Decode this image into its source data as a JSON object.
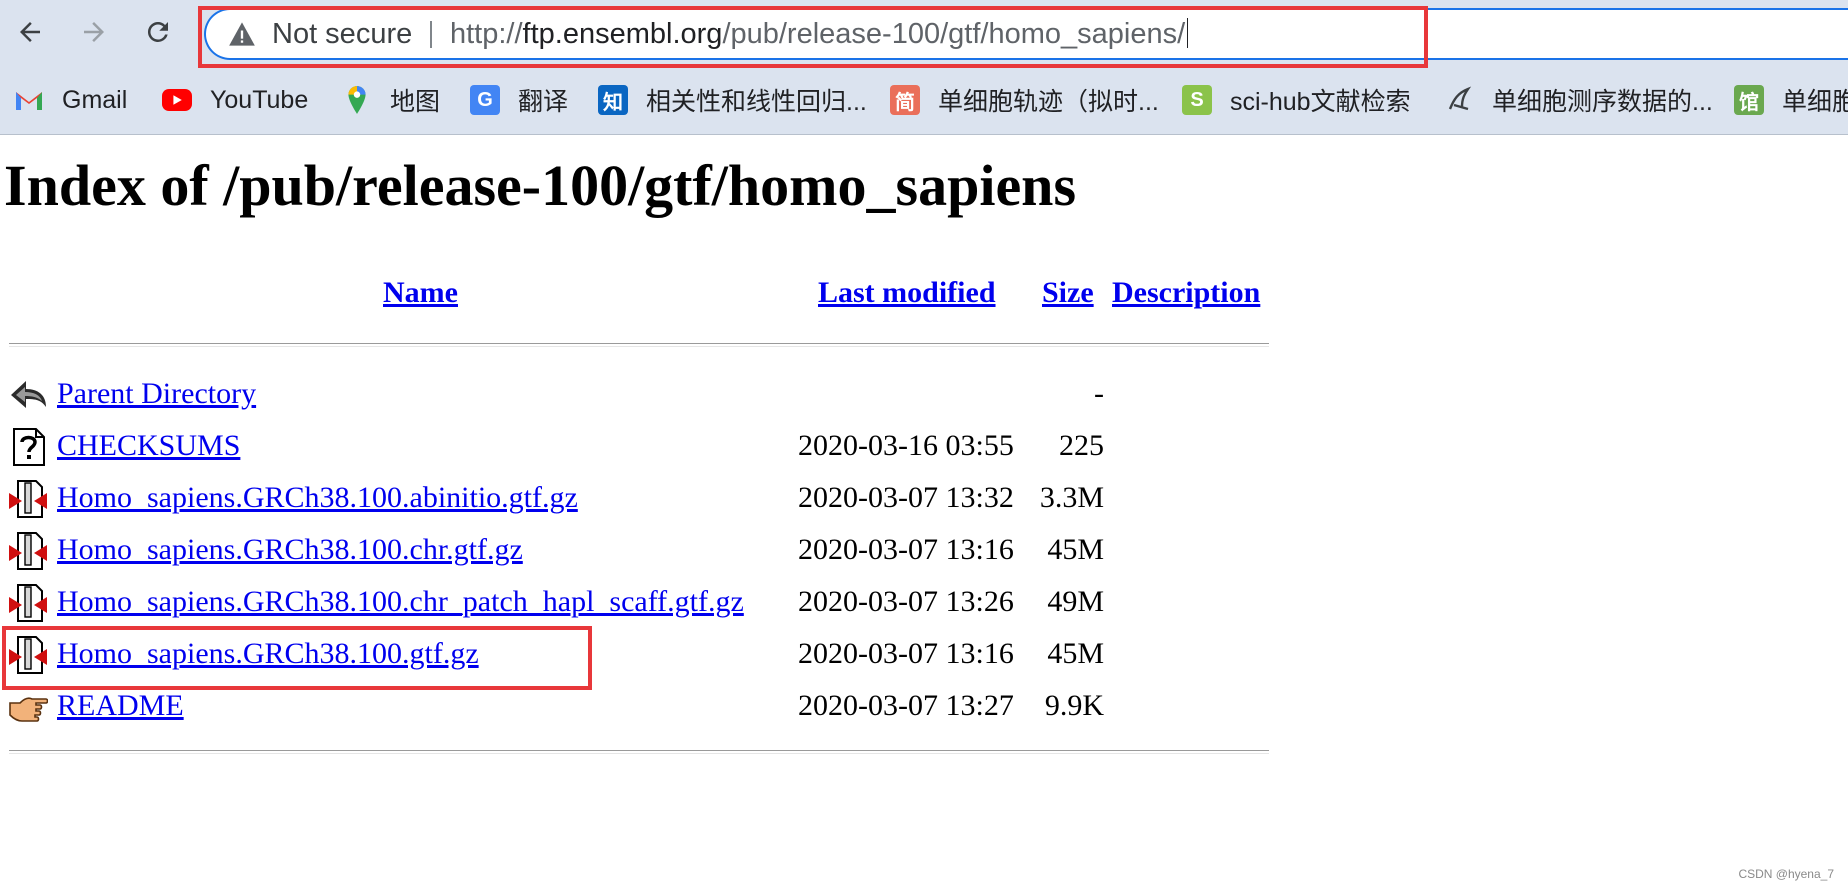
{
  "browser": {
    "back_label": "Back",
    "forward_label": "Forward",
    "reload_label": "Reload",
    "security_text": "Not secure",
    "url_scheme": "http://",
    "url_host": "ftp.ensembl.org",
    "url_path": "/pub/release-100/gtf/homo_sapiens/"
  },
  "bookmarks": [
    {
      "label": "Gmail",
      "icon": "gmail-icon"
    },
    {
      "label": "YouTube",
      "icon": "youtube-icon"
    },
    {
      "label": "地图",
      "icon": "maps-pin-icon"
    },
    {
      "label": "翻译",
      "icon": "translate-icon",
      "glyph": "G"
    },
    {
      "label": "相关性和线性回归...",
      "icon": "zhihu-icon",
      "glyph": "知"
    },
    {
      "label": "单细胞轨迹（拟时...",
      "icon": "jianshu-icon",
      "glyph": "简"
    },
    {
      "label": "sci-hub文献检索",
      "icon": "scihub-icon",
      "glyph": "S"
    },
    {
      "label": "单细胞测序数据的...",
      "icon": "bird-icon"
    },
    {
      "label": "单细胞",
      "icon": "library-icon",
      "glyph": "馆"
    }
  ],
  "page": {
    "title": "Index of /pub/release-100/gtf/homo_sapiens",
    "columns": {
      "name": "Name",
      "last_modified": "Last modified",
      "size": "Size",
      "description": "Description"
    },
    "rows": [
      {
        "name": "Parent Directory",
        "date": "",
        "size": "-",
        "icon": "back-arrow-icon"
      },
      {
        "name": "CHECKSUMS",
        "date": "2020-03-16 03:55",
        "size": "225",
        "icon": "unknown-file-icon"
      },
      {
        "name": "Homo_sapiens.GRCh38.100.abinitio.gtf.gz",
        "date": "2020-03-07 13:32",
        "size": "3.3M",
        "icon": "compressed-file-icon"
      },
      {
        "name": "Homo_sapiens.GRCh38.100.chr.gtf.gz",
        "date": "2020-03-07 13:16",
        "size": "45M",
        "icon": "compressed-file-icon"
      },
      {
        "name": "Homo_sapiens.GRCh38.100.chr_patch_hapl_scaff.gtf.gz",
        "date": "2020-03-07 13:26",
        "size": "49M",
        "icon": "compressed-file-icon"
      },
      {
        "name": "Homo_sapiens.GRCh38.100.gtf.gz",
        "date": "2020-03-07 13:16",
        "size": "45M",
        "icon": "compressed-file-icon"
      },
      {
        "name": "README",
        "date": "2020-03-07 13:27",
        "size": "9.9K",
        "icon": "hand-pointer-icon"
      }
    ]
  },
  "watermark": "CSDN @hyena_7",
  "colors": {
    "link": "#0000ee",
    "annotation": "#e8373a",
    "chrome": "#dbe3ef"
  }
}
